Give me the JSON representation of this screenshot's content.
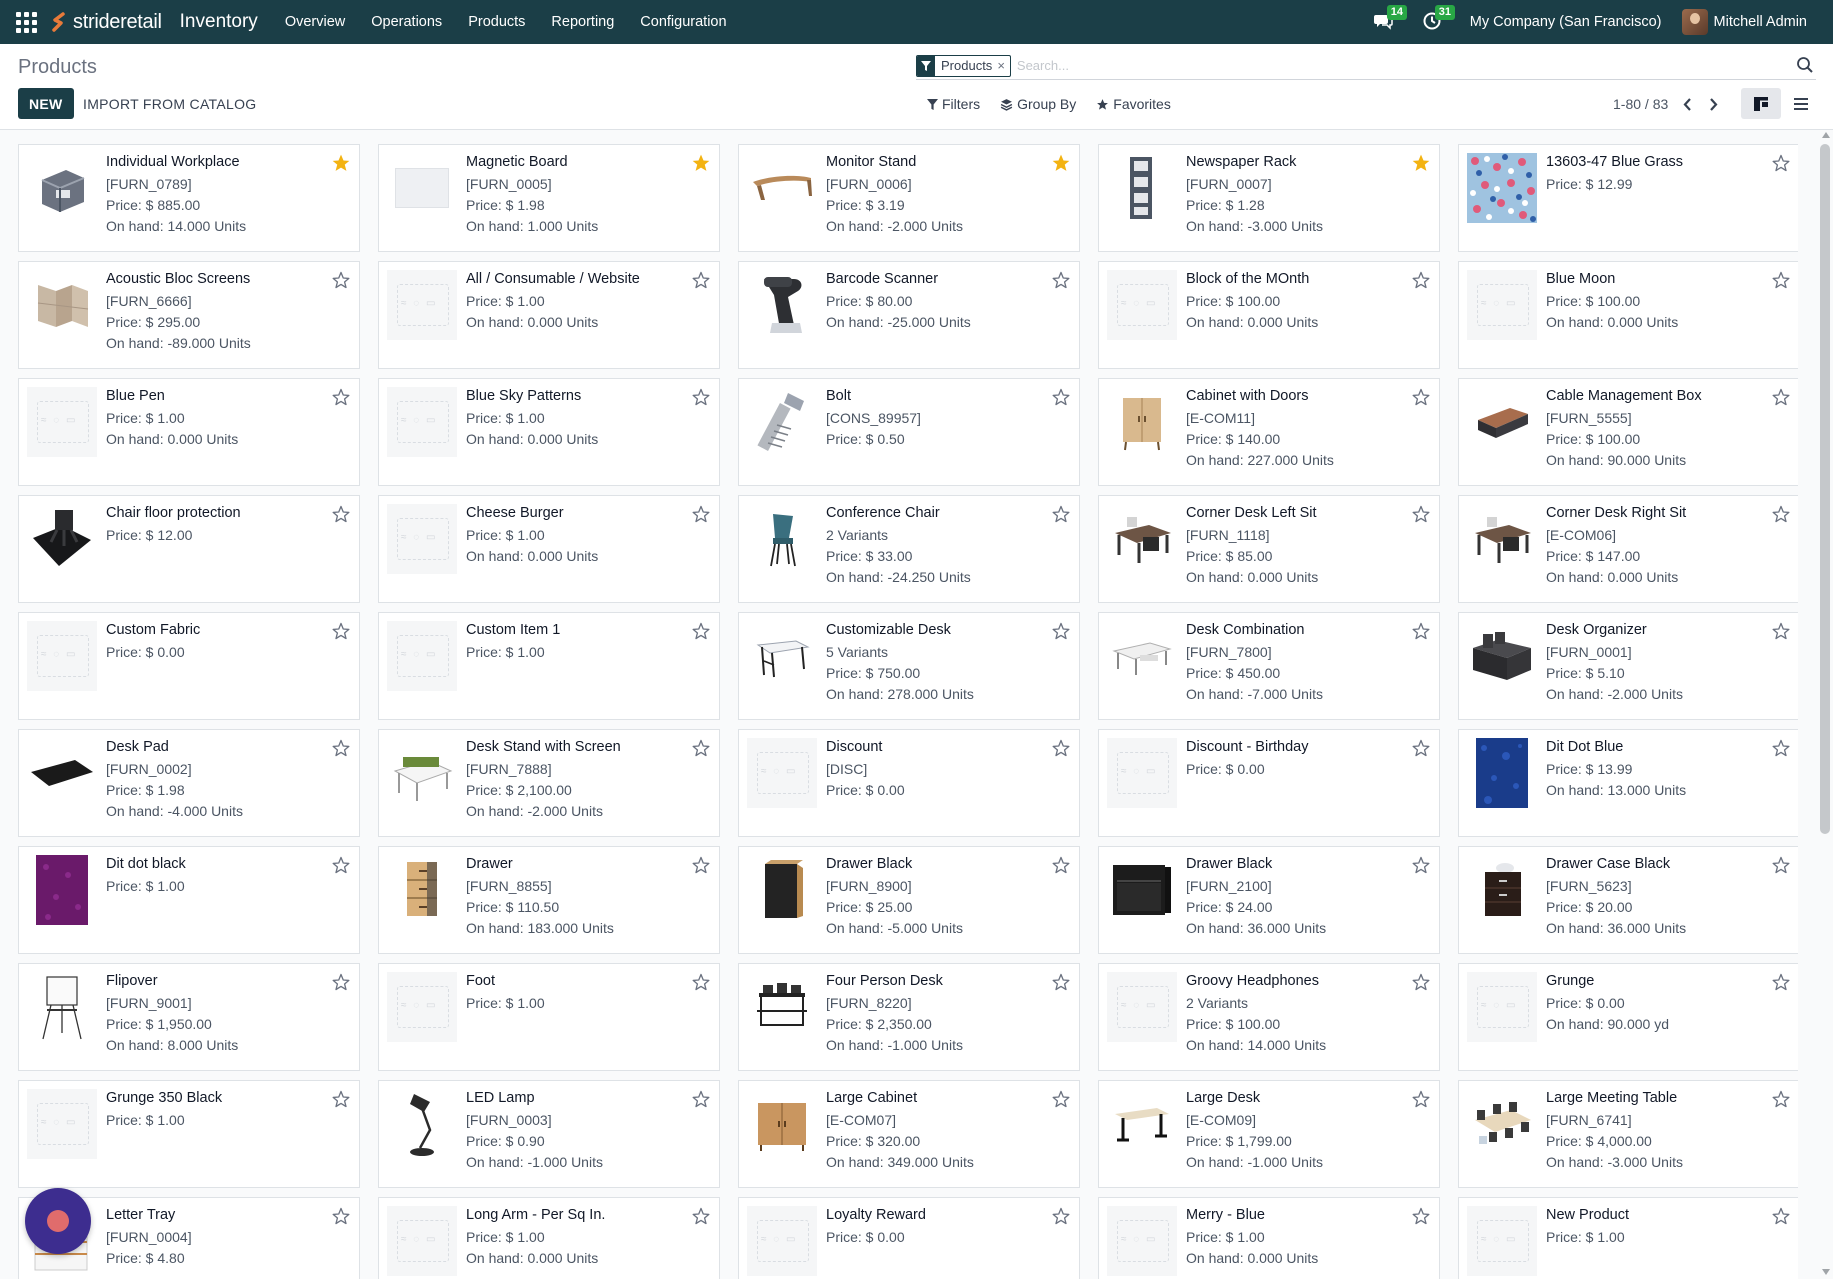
{
  "navbar": {
    "brand": "strideretail",
    "app_name": "Inventory",
    "menu": [
      "Overview",
      "Operations",
      "Products",
      "Reporting",
      "Configuration"
    ],
    "messages_count": "14",
    "activities_count": "31",
    "company": "My Company (San Francisco)",
    "user": "Mitchell Admin"
  },
  "control": {
    "title": "Products",
    "new_label": "NEW",
    "import_label": "IMPORT FROM CATALOG",
    "facet_label": "Products",
    "facet_close": "×",
    "search_placeholder": "Search...",
    "filters_label": "Filters",
    "groupby_label": "Group By",
    "favorites_label": "Favorites",
    "pager": "1-80 / 83"
  },
  "colors": {
    "navbar": "#1b3e47",
    "star_active": "#f3b312",
    "star_inactive": "#6b7280"
  },
  "products": [
    {
      "name": "Individual Workplace",
      "lines": [
        "[FURN_0789]",
        "Price: $ 885.00",
        "On hand: 14.000 Units"
      ],
      "fav": true,
      "img": "workplace"
    },
    {
      "name": "Magnetic Board",
      "lines": [
        "[FURN_0005]",
        "Price: $ 1.98",
        "On hand: 1.000 Units"
      ],
      "fav": true,
      "img": "board"
    },
    {
      "name": "Monitor Stand",
      "lines": [
        "[FURN_0006]",
        "Price: $ 3.19",
        "On hand: -2.000 Units"
      ],
      "fav": true,
      "img": "monitor-stand"
    },
    {
      "name": "Newspaper Rack",
      "lines": [
        "[FURN_0007]",
        "Price: $ 1.28",
        "On hand: -3.000 Units"
      ],
      "fav": true,
      "img": "rack"
    },
    {
      "name": "13603-47 Blue Grass",
      "lines": [
        "Price: $ 12.99"
      ],
      "fav": false,
      "img": "fabric-floral"
    },
    {
      "name": "Acoustic Bloc Screens",
      "lines": [
        "[FURN_6666]",
        "Price: $ 295.00",
        "On hand: -89.000 Units"
      ],
      "fav": false,
      "img": "screens"
    },
    {
      "name": "All / Consumable / Website",
      "lines": [
        "Price: $ 1.00",
        "On hand: 0.000 Units"
      ],
      "fav": false,
      "img": "placeholder"
    },
    {
      "name": "Barcode Scanner",
      "lines": [
        "Price: $ 80.00",
        "On hand: -25.000 Units"
      ],
      "fav": false,
      "img": "scanner"
    },
    {
      "name": "Block of the MOnth",
      "lines": [
        "Price: $ 100.00",
        "On hand: 0.000 Units"
      ],
      "fav": false,
      "img": "placeholder"
    },
    {
      "name": "Blue Moon",
      "lines": [
        "Price: $ 100.00",
        "On hand: 0.000 Units"
      ],
      "fav": false,
      "img": "placeholder"
    },
    {
      "name": "Blue Pen",
      "lines": [
        "Price: $ 1.00",
        "On hand: 0.000 Units"
      ],
      "fav": false,
      "img": "placeholder"
    },
    {
      "name": "Blue Sky Patterns",
      "lines": [
        "Price: $ 1.00",
        "On hand: 0.000 Units"
      ],
      "fav": false,
      "img": "placeholder"
    },
    {
      "name": "Bolt",
      "lines": [
        "[CONS_89957]",
        "Price: $ 0.50"
      ],
      "fav": false,
      "img": "bolt"
    },
    {
      "name": "Cabinet with Doors",
      "lines": [
        "[E-COM11]",
        "Price: $ 140.00",
        "On hand: 227.000 Units"
      ],
      "fav": false,
      "img": "cabinet-doors"
    },
    {
      "name": "Cable Management Box",
      "lines": [
        "[FURN_5555]",
        "Price: $ 100.00",
        "On hand: 90.000 Units"
      ],
      "fav": false,
      "img": "cable-box"
    },
    {
      "name": "Chair floor protection",
      "lines": [
        "Price: $ 12.00"
      ],
      "fav": false,
      "img": "floor-mat"
    },
    {
      "name": "Cheese Burger",
      "lines": [
        "Price: $ 1.00",
        "On hand: 0.000 Units"
      ],
      "fav": false,
      "img": "placeholder"
    },
    {
      "name": "Conference Chair",
      "lines": [
        "2 Variants",
        "Price: $ 33.00",
        "On hand: -24.250 Units"
      ],
      "fav": false,
      "img": "chair"
    },
    {
      "name": "Corner Desk Left Sit",
      "lines": [
        "[FURN_1118]",
        "Price: $ 85.00",
        "On hand: 0.000 Units"
      ],
      "fav": false,
      "img": "corner-desk"
    },
    {
      "name": "Corner Desk Right Sit",
      "lines": [
        "[E-COM06]",
        "Price: $ 147.00",
        "On hand: 0.000 Units"
      ],
      "fav": false,
      "img": "corner-desk"
    },
    {
      "name": "Custom Fabric",
      "lines": [
        "Price: $ 0.00"
      ],
      "fav": false,
      "img": "placeholder"
    },
    {
      "name": "Custom Item 1",
      "lines": [
        "Price: $ 1.00"
      ],
      "fav": false,
      "img": "placeholder"
    },
    {
      "name": "Customizable Desk",
      "lines": [
        "5 Variants",
        "Price: $ 750.00",
        "On hand: 278.000 Units"
      ],
      "fav": false,
      "img": "desk-white"
    },
    {
      "name": "Desk Combination",
      "lines": [
        "[FURN_7800]",
        "Price: $ 450.00",
        "On hand: -7.000 Units"
      ],
      "fav": false,
      "img": "desk-combo"
    },
    {
      "name": "Desk Organizer",
      "lines": [
        "[FURN_0001]",
        "Price: $ 5.10",
        "On hand: -2.000 Units"
      ],
      "fav": false,
      "img": "organizer"
    },
    {
      "name": "Desk Pad",
      "lines": [
        "[FURN_0002]",
        "Price: $ 1.98",
        "On hand: -4.000 Units"
      ],
      "fav": false,
      "img": "desk-pad"
    },
    {
      "name": "Desk Stand with Screen",
      "lines": [
        "[FURN_7888]",
        "Price: $ 2,100.00",
        "On hand: -2.000 Units"
      ],
      "fav": false,
      "img": "desk-screen"
    },
    {
      "name": "Discount",
      "lines": [
        "[DISC]",
        "Price: $ 0.00"
      ],
      "fav": false,
      "img": "placeholder"
    },
    {
      "name": "Discount - Birthday",
      "lines": [
        "Price: $ 0.00"
      ],
      "fav": false,
      "img": "placeholder"
    },
    {
      "name": "Dit Dot Blue",
      "lines": [
        "Price: $ 13.99",
        "On hand: 13.000 Units"
      ],
      "fav": false,
      "img": "fabric-blue"
    },
    {
      "name": "Dit dot black",
      "lines": [
        "Price: $ 1.00"
      ],
      "fav": false,
      "img": "fabric-purple"
    },
    {
      "name": "Drawer",
      "lines": [
        "[FURN_8855]",
        "Price: $ 110.50",
        "On hand: 183.000 Units"
      ],
      "fav": false,
      "img": "drawer-wood"
    },
    {
      "name": "Drawer Black",
      "lines": [
        "[FURN_8900]",
        "Price: $ 25.00",
        "On hand: -5.000 Units"
      ],
      "fav": false,
      "img": "drawer-black"
    },
    {
      "name": "Drawer Black",
      "lines": [
        "[FURN_2100]",
        "Price: $ 24.00",
        "On hand: 36.000 Units"
      ],
      "fav": false,
      "img": "drawer-black2"
    },
    {
      "name": "Drawer Case Black",
      "lines": [
        "[FURN_5623]",
        "Price: $ 20.00",
        "On hand: 36.000 Units"
      ],
      "fav": false,
      "img": "drawer-case"
    },
    {
      "name": "Flipover",
      "lines": [
        "[FURN_9001]",
        "Price: $ 1,950.00",
        "On hand: 8.000 Units"
      ],
      "fav": false,
      "img": "flipover"
    },
    {
      "name": "Foot",
      "lines": [
        "Price: $ 1.00"
      ],
      "fav": false,
      "img": "placeholder"
    },
    {
      "name": "Four Person Desk",
      "lines": [
        "[FURN_8220]",
        "Price: $ 2,350.00",
        "On hand: -1.000 Units"
      ],
      "fav": false,
      "img": "four-desk"
    },
    {
      "name": "Groovy Headphones",
      "lines": [
        "2 Variants",
        "Price: $ 100.00",
        "On hand: 14.000 Units"
      ],
      "fav": false,
      "img": "placeholder"
    },
    {
      "name": "Grunge",
      "lines": [
        "Price: $ 0.00",
        "On hand: 90.000 yd"
      ],
      "fav": false,
      "img": "placeholder"
    },
    {
      "name": "Grunge 350 Black",
      "lines": [
        "Price: $ 1.00"
      ],
      "fav": false,
      "img": "placeholder"
    },
    {
      "name": "LED Lamp",
      "lines": [
        "[FURN_0003]",
        "Price: $ 0.90",
        "On hand: -1.000 Units"
      ],
      "fav": false,
      "img": "lamp"
    },
    {
      "name": "Large Cabinet",
      "lines": [
        "[E-COM07]",
        "Price: $ 320.00",
        "On hand: 349.000 Units"
      ],
      "fav": false,
      "img": "large-cabinet"
    },
    {
      "name": "Large Desk",
      "lines": [
        "[E-COM09]",
        "Price: $ 1,799.00",
        "On hand: -1.000 Units"
      ],
      "fav": false,
      "img": "large-desk"
    },
    {
      "name": "Large Meeting Table",
      "lines": [
        "[FURN_6741]",
        "Price: $ 4,000.00",
        "On hand: -3.000 Units"
      ],
      "fav": false,
      "img": "meeting-table"
    },
    {
      "name": "Letter Tray",
      "lines": [
        "[FURN_0004]",
        "Price: $ 4.80"
      ],
      "fav": false,
      "img": "letter-tray"
    },
    {
      "name": "Long Arm - Per Sq In.",
      "lines": [
        "Price: $ 1.00",
        "On hand: 0.000 Units"
      ],
      "fav": false,
      "img": "placeholder"
    },
    {
      "name": "Loyalty Reward",
      "lines": [
        "Price: $ 0.00"
      ],
      "fav": false,
      "img": "placeholder"
    },
    {
      "name": "Merry - Blue",
      "lines": [
        "Price: $ 1.00",
        "On hand: 0.000 Units"
      ],
      "fav": false,
      "img": "placeholder"
    },
    {
      "name": "New Product",
      "lines": [
        "Price: $ 1.00"
      ],
      "fav": false,
      "img": "placeholder"
    }
  ]
}
